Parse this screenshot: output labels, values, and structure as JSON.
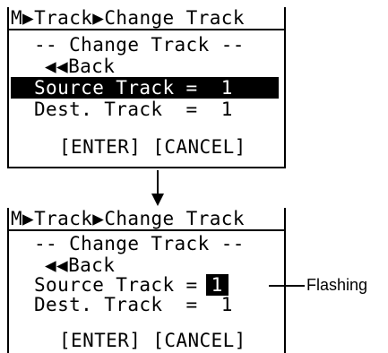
{
  "screen_before": {
    "breadcrumb": "M▶Track▶Change Track",
    "heading": "-- Change Track --",
    "back": "◀◀Back",
    "source_track_row": "Source Track =  1",
    "dest_track_row": "Dest. Track  =  1",
    "buttons_row": "[ENTER] [CANCEL]"
  },
  "screen_after": {
    "breadcrumb": "M▶Track▶Change Track",
    "heading": "-- Change Track --",
    "back": "◀◀Back",
    "source_track_label": "Source Track = ",
    "source_track_value": "1",
    "dest_track_row": "Dest. Track  =  1",
    "buttons_row": "[ENTER] [CANCEL]"
  },
  "annotation": {
    "flashing_label": "Flashing"
  }
}
